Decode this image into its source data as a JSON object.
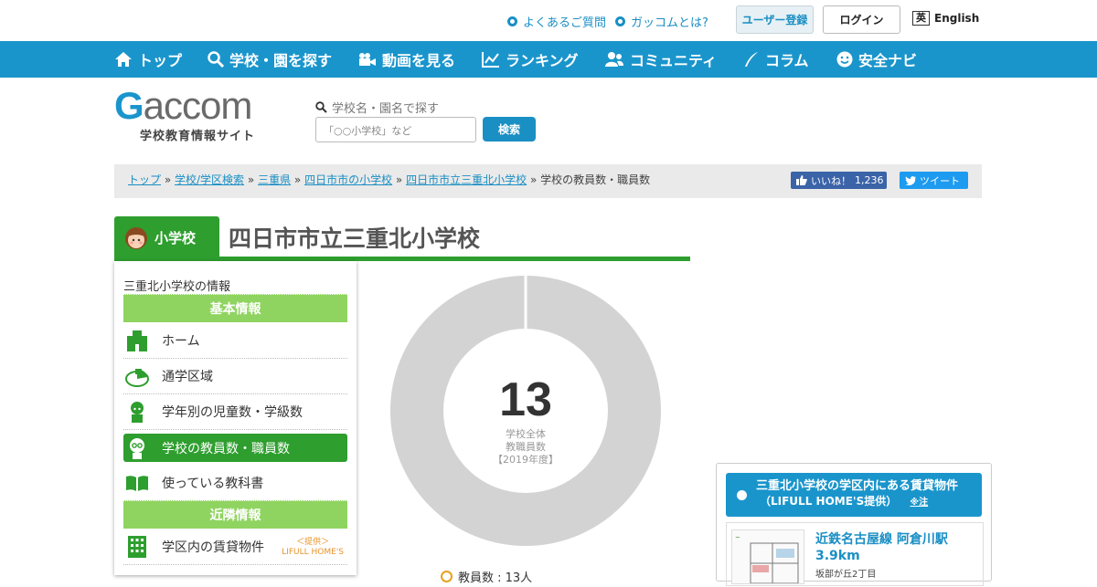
{
  "header": {
    "faq": "よくあるご質問",
    "about": "ガッコムとは?",
    "register": "ユーザー登録",
    "login": "ログイン",
    "lang_badge": "英",
    "lang": "English"
  },
  "nav": [
    {
      "label": "トップ",
      "icon": "home-icon"
    },
    {
      "label": "学校・園を探す",
      "icon": "search-icon"
    },
    {
      "label": "動画を見る",
      "icon": "video-icon"
    },
    {
      "label": "ランキング",
      "icon": "chart-icon"
    },
    {
      "label": "コミュニティ",
      "icon": "people-icon"
    },
    {
      "label": "コラム",
      "icon": "pen-icon"
    },
    {
      "label": "安全ナビ",
      "icon": "smile-icon"
    }
  ],
  "logo": {
    "letter": "G",
    "word": "accom",
    "sub": "学校教育情報サイト"
  },
  "search": {
    "label": "学校名・園名で探す",
    "placeholder": "「○○小学校」など",
    "button": "検索"
  },
  "breadcrumb": {
    "links": [
      "トップ",
      "学校/学区検索",
      "三重県",
      "四日市市の小学校",
      "四日市市立三重北小学校"
    ],
    "current": "学校の教員数・職員数",
    "sep": "»"
  },
  "social": {
    "like": "いいね！",
    "like_count": "1,236",
    "tweet": "ツイート"
  },
  "school": {
    "type": "小学校",
    "name": "四日市市立三重北小学校"
  },
  "sidebar": {
    "title": "三重北小学校の情報",
    "section1": "基本情報",
    "items": [
      {
        "label": "ホーム",
        "icon": "school-building-icon"
      },
      {
        "label": "通学区域",
        "icon": "map-area-icon"
      },
      {
        "label": "学年別の児童数・学級数",
        "icon": "student-icon"
      },
      {
        "label": "学校の教員数・職員数",
        "icon": "teacher-icon"
      },
      {
        "label": "使っている教科書",
        "icon": "book-icon"
      }
    ],
    "section2": "近隣情報",
    "nearby": [
      {
        "label": "学区内の賃貸物件",
        "icon": "apartment-icon",
        "provider_top": "＜提供＞",
        "provider": "LIFULL HOME'S"
      }
    ]
  },
  "staff": {
    "number": "13",
    "line1": "学校全体",
    "line2": "教職員数",
    "line3": "【2019年度】",
    "teachers_label": "教員数 : 13人",
    "ring_color": "#d3d3d3"
  },
  "rental": {
    "title": "三重北小学校の学区内にある賃貸物件",
    "sub": "（LIFULL HOME'S提供）",
    "note": "※注",
    "line": "近鉄名古屋線 阿倉川駅",
    "dist": "3.9km",
    "addr": "坂部が丘2丁目"
  },
  "colors": {
    "nav": "#1a95cc",
    "green": "#2e9e2e",
    "light_green": "#8fd460"
  }
}
